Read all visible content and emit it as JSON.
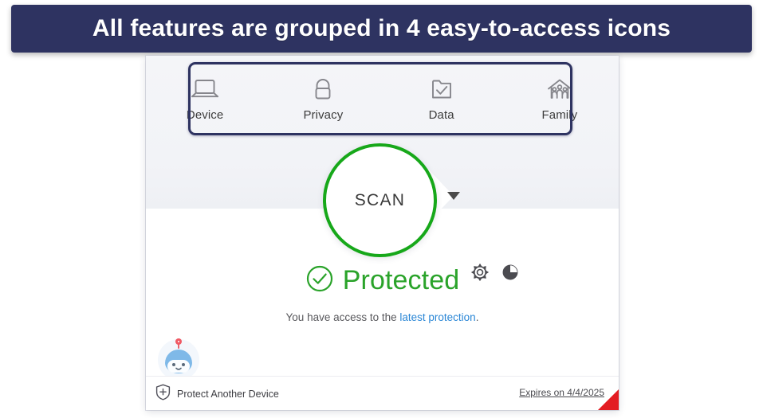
{
  "banner": {
    "text": "All features are grouped in 4 easy-to-access icons",
    "background_color": "#2e3361",
    "text_color": "#ffffff"
  },
  "app": {
    "toolbar": {
      "highlighted": true,
      "highlight_color": "#2e3361",
      "items": [
        {
          "label": "Device",
          "icon": "laptop-icon"
        },
        {
          "label": "Privacy",
          "icon": "lock-icon"
        },
        {
          "label": "Data",
          "icon": "folder-check-icon"
        },
        {
          "label": "Family",
          "icon": "house-family-icon"
        }
      ]
    },
    "scan": {
      "label": "SCAN",
      "ring_color": "#17a81a",
      "dropdown_icon": "chevron-down-icon"
    },
    "quick_actions": [
      {
        "name": "settings",
        "icon": "gear-icon"
      },
      {
        "name": "reports",
        "icon": "pie-chart-icon"
      }
    ],
    "status": {
      "icon": "check-circle-icon",
      "title": "Protected",
      "title_color": "#2aa32a",
      "subtitle_prefix": "You have access to the ",
      "subtitle_link": "latest protection",
      "subtitle_suffix": ".",
      "link_color": "#2b87d6"
    },
    "assistant": {
      "icon": "robot-avatar-icon"
    },
    "footer": {
      "protect_icon": "shield-plus-icon",
      "protect_label": "Protect Another Device",
      "expires_label": "Expires on 4/4/2025",
      "corner_color": "#e31c22"
    }
  }
}
